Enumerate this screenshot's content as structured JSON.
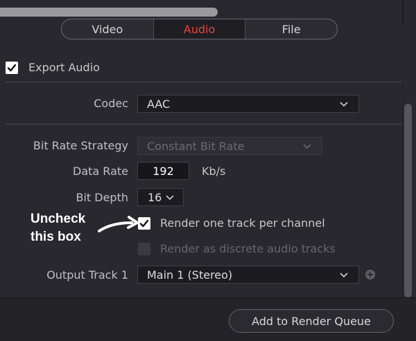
{
  "tabs": [
    {
      "label": "Video"
    },
    {
      "label": "Audio",
      "active": true
    },
    {
      "label": "File"
    }
  ],
  "export_audio": {
    "label": "Export Audio",
    "checked": true
  },
  "codec": {
    "label": "Codec",
    "value": "AAC"
  },
  "bit_rate_strategy": {
    "label": "Bit Rate Strategy",
    "value": "Constant Bit Rate",
    "disabled": true
  },
  "data_rate": {
    "label": "Data Rate",
    "value": "192",
    "unit": "Kb/s"
  },
  "bit_depth": {
    "label": "Bit Depth",
    "value": "16"
  },
  "render_one_track": {
    "label": "Render one track per channel",
    "checked": true
  },
  "render_discrete": {
    "label": "Render as discrete audio tracks",
    "checked": false,
    "disabled": true
  },
  "output_track": {
    "label": "Output Track 1",
    "value": "Main 1 (Stereo)"
  },
  "add_button": {
    "label": "Add to Render Queue"
  },
  "annotation": {
    "line1": "Uncheck",
    "line2": "this box"
  },
  "colors": {
    "accent": "#e8433a",
    "background": "#28282e",
    "input_bg": "#1c1c20"
  },
  "icons": [
    "checkmark-icon",
    "chevron-down-icon",
    "plus-icon",
    "curved-arrow-icon"
  ]
}
